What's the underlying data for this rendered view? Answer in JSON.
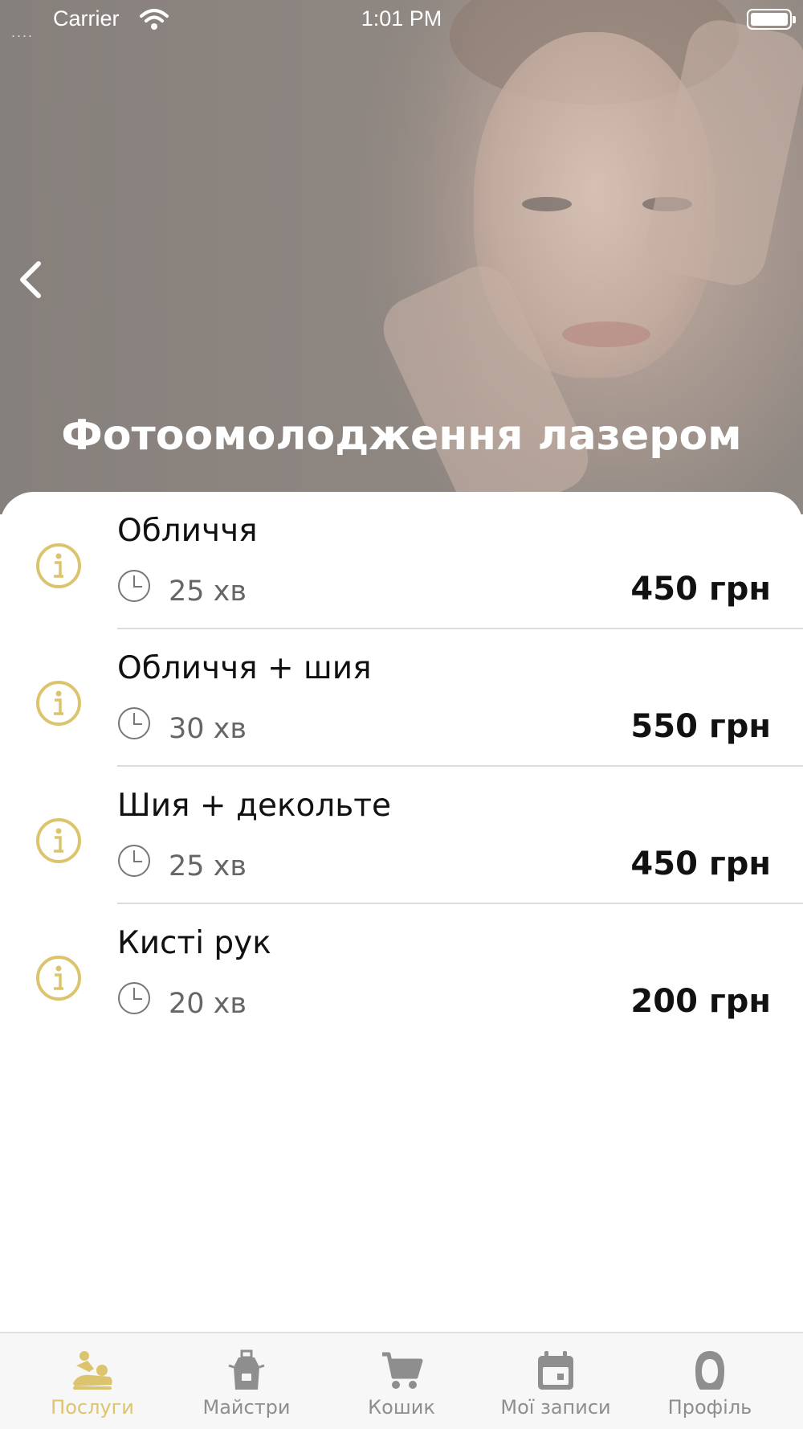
{
  "status_bar": {
    "carrier": "Carrier",
    "time": "1:01 PM",
    "signal_dots": "...."
  },
  "header": {
    "title": "Фотоомолодження лазером"
  },
  "services": [
    {
      "name": "Обличчя",
      "duration": "25 хв",
      "price": "450 грн"
    },
    {
      "name": "Обличчя + шия",
      "duration": "30 хв",
      "price": "550 грн"
    },
    {
      "name": "Шия + декольте",
      "duration": "25 хв",
      "price": "450 грн"
    },
    {
      "name": "Кисті рук",
      "duration": "20 хв",
      "price": "200 грн"
    }
  ],
  "tabs": [
    {
      "label": "Послуги",
      "icon": "massage-icon",
      "active": true
    },
    {
      "label": "Майстри",
      "icon": "apron-icon",
      "active": false
    },
    {
      "label": "Кошик",
      "icon": "cart-icon",
      "active": false
    },
    {
      "label": "Мої записи",
      "icon": "calendar-icon",
      "active": false
    },
    {
      "label": "Профіль",
      "icon": "profile-icon",
      "active": false
    }
  ],
  "colors": {
    "accent": "#dcc46e",
    "inactive": "#8e8e8e",
    "text": "#111111",
    "muted": "#666666"
  }
}
